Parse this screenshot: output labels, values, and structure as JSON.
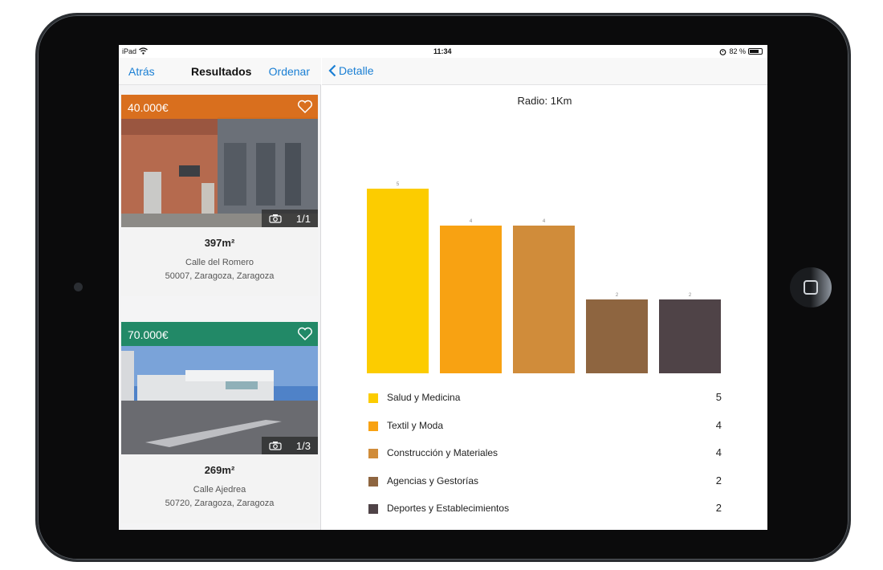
{
  "status_bar": {
    "carrier": "iPad",
    "time": "11:34",
    "battery": "82 %",
    "battery_level": 0.82
  },
  "left_nav": {
    "back": "Atrás",
    "title": "Resultados",
    "sort": "Ordenar"
  },
  "listings": [
    {
      "price": "40.000€",
      "band_color": "#e06a10",
      "photo_count": "1/1",
      "area": "397m²",
      "street": "Calle del Romero",
      "city": "50007, Zaragoza, Zaragoza"
    },
    {
      "price": "70.000€",
      "band_color": "#1e8a5e",
      "photo_count": "1/3",
      "area": "269m²",
      "street": "Calle Ajedrea",
      "city": "50720, Zaragoza, Zaragoza"
    }
  ],
  "detail_nav": {
    "back": "Detalle"
  },
  "chart_data": {
    "type": "bar",
    "title": "Radio: 1Km",
    "categories": [
      "Salud y Medicina",
      "Textil y Moda",
      "Construcción y Materiales",
      "Agencias y Gestorías",
      "Deportes y Establecimientos"
    ],
    "values": [
      5,
      4,
      4,
      2,
      2
    ],
    "colors": [
      "#fccc00",
      "#f8a212",
      "#d08c3a",
      "#8e6540",
      "#4f4347"
    ],
    "ylim": [
      0,
      5
    ],
    "grid": false,
    "legend": "bottom"
  },
  "icons": {
    "heart": "heart-icon",
    "camera": "camera-icon",
    "wifi": "wifi-icon",
    "alarm": "alarm-icon",
    "battery": "battery-icon",
    "back": "chevron-left-icon"
  }
}
